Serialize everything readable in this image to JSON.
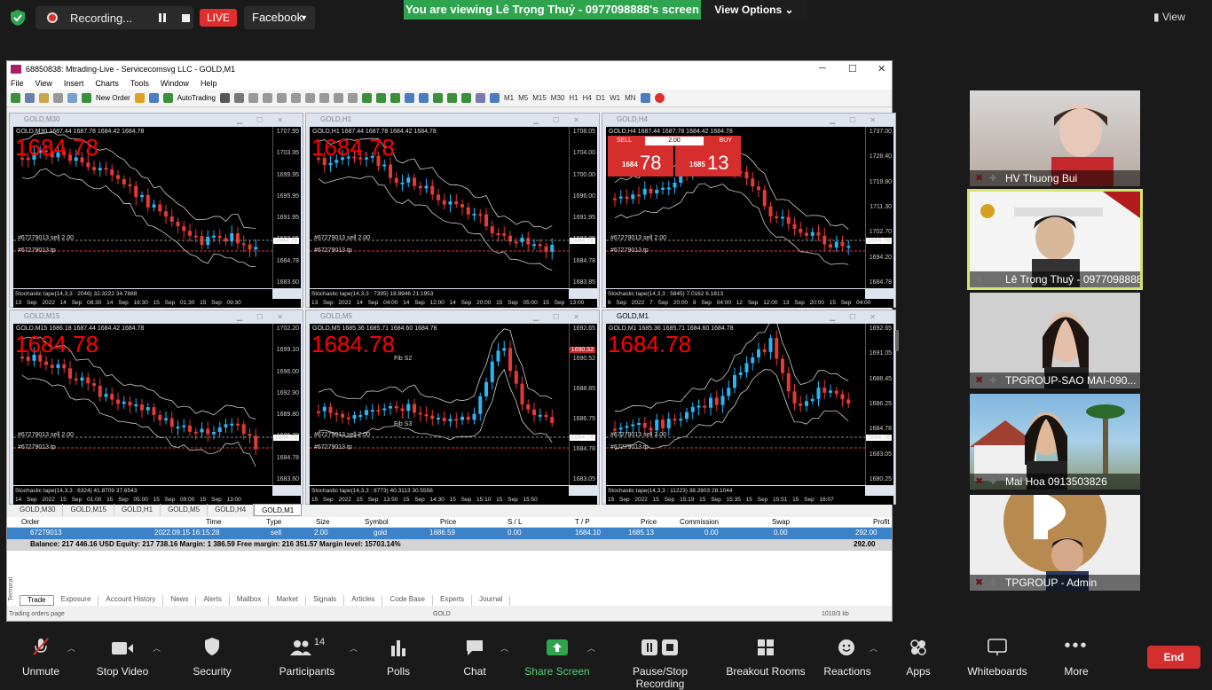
{
  "zoom": {
    "recording_label": "Recording...",
    "live_label": "LIVE",
    "stream_target": "Facebook",
    "viewing_banner": "You are viewing Lê Trọng Thuỷ - 0977098888's screen",
    "view_options": "View Options",
    "view_label": "View"
  },
  "mt": {
    "title": "68850838: Mtrading-Live - Servicecomsvg LLC - GOLD,M1",
    "menu": [
      "File",
      "View",
      "Insert",
      "Charts",
      "Tools",
      "Window",
      "Help"
    ],
    "toolbar": {
      "new_order": "New Order",
      "autotrading": "AutoTrading",
      "timeframes": [
        "M1",
        "M5",
        "M15",
        "M30",
        "H1",
        "H4",
        "D1",
        "W1",
        "MN"
      ]
    },
    "charts": [
      {
        "title": "GOLD,M30",
        "ohlc": "GOLD,M30  1687.44 1687.78 1684.42 1684.78",
        "price": "1684.78",
        "ord1": "#67279013 sell 2.00",
        "ord2": "#67279013 tp",
        "stoch": "Stochastic tape(14,3,3 : 2046) 32.3222 34.7888",
        "xaxis": "13 Sep 2022  14 Sep 08:30  14 Sep 16:30  15 Sep 01:30  15 Sep 09:30",
        "yticks": [
          "1707.95",
          "1703.95",
          "1699.95",
          "1695.95",
          "1691.95",
          "1687.95",
          "1684.78",
          "1683.60"
        ],
        "tag": "1684.78"
      },
      {
        "title": "GOLD,H1",
        "ohlc": "GOLD,H1  1687.44 1687.78 1684.42 1684.78",
        "price": "1684.78",
        "ord1": "#67279013 sell 2.00",
        "ord2": "#67279013 tp",
        "stoch": "Stochastic tape(14,3,3 : 7395) 18.8946 21.1953",
        "xaxis": "13 Sep 2022  14 Sep 04:00  14 Sep 12:00  14 Sep 20:00  15 Sep 05:00  15 Sep 13:00",
        "yticks": [
          "1708.05",
          "1704.00",
          "1700.00",
          "1696.00",
          "1691.95",
          "1687.95",
          "1684.78",
          "1683.85"
        ],
        "tag": "1684.78"
      },
      {
        "title": "GOLD,H4",
        "ohlc": "GOLD,H4  1687.44 1687.78 1684.42 1684.78",
        "ord1": "#67279013 sell 2.00",
        "ord2": "#67279013 tp",
        "stoch": "Stochastic tape(14,3,3 : 5845) 7.0162 6.1813",
        "xaxis": "6 Sep 2022  7 Sep 20:00  9 Sep 04:00  12 Sep 12:00  13 Sep 20:00  15 Sep 04:00",
        "yticks": [
          "1737.00",
          "1728.40",
          "1719.80",
          "1711.30",
          "1702.70",
          "1694.20",
          "1684.78"
        ],
        "tag": "1684.78",
        "trade": {
          "sell": "SELL",
          "buy": "BUY",
          "lot": "2.00",
          "sell_small": "1684",
          "sell_big": "78",
          "buy_small": "1685",
          "buy_big": "13"
        }
      },
      {
        "title": "GOLD,M15",
        "ohlc": "GOLD,M15  1686.18 1687.44 1684.42 1684.78",
        "price": "1684.78",
        "ord1": "#67279013 sell 2.00",
        "ord2": "#67279013 tp",
        "stoch": "Stochastic tape(14,3,3 : 6324) 41.8709 37.6543",
        "xaxis": "14 Sep 2022  15 Sep 01:00  15 Sep 05:00  15 Sep 09:00  15 Sep 13:00",
        "yticks": [
          "1702.20",
          "1699.10",
          "1696.00",
          "1692.90",
          "1689.80",
          "1686.70",
          "1684.78",
          "1683.60"
        ],
        "tag": "1684.78"
      },
      {
        "title": "GOLD,M5",
        "ohlc": "GOLD,M5  1685.36 1685.71 1684.60 1684.78",
        "price": "1684.78",
        "ord1": "#67279013 sell 2.00",
        "ord2": "#67279013 tp",
        "fib1": "Fib S2",
        "fib2": "Fib S3",
        "stoch": "Stochastic tape(14,3,3 : 8773) 40.3113 30.5556",
        "xaxis": "15 Sep 2022  15 Sep 13:50  15 Sep 14:30  15 Sep 15:10  15 Sep 15:50",
        "yticks": [
          "1692.65",
          "1690.52",
          "1688.85",
          "1686.75",
          "1684.78",
          "1683.05"
        ],
        "tag": "1684.78",
        "tag2": "1690.52"
      },
      {
        "title": "GOLD,M1",
        "ohlc": "GOLD,M1  1685.36 1685.71 1684.60 1684.78",
        "price": "1684.78",
        "ord1": "#67279013 sell 2.00",
        "ord2": "#67279013 tp",
        "stoch": "Stochastic tape(14,3,3 : 11223) 38.2803 28.1044",
        "xaxis": "15 Sep 2022  15 Sep 15:19  15 Sep 15:35  15 Sep 15:51  15 Sep 16:07",
        "yticks": [
          "1692.65",
          "1691.05",
          "1688.45",
          "1686.25",
          "1684.78",
          "1683.05",
          "1680.25"
        ],
        "tag": "1684.78"
      }
    ],
    "chart_tabs": [
      "GOLD,M30",
      "GOLD,M15",
      "GOLD,H1",
      "GOLD,M5",
      "GOLD,H4",
      "GOLD,M1"
    ],
    "terminal": {
      "headers": [
        "Order",
        "Time",
        "Type",
        "Size",
        "Symbol",
        "Price",
        "S / L",
        "T / P",
        "Price",
        "Commission",
        "Swap",
        "Profit"
      ],
      "row": [
        "67279013",
        "2022.09.15 16:15:28",
        "sell",
        "2.00",
        "gold",
        "1686.59",
        "0.00",
        "1684.10",
        "1685.13",
        "0.00",
        "0.00",
        "292.00"
      ],
      "balance": "Balance: 217 446.16 USD  Equity: 217 738.16  Margin: 1 386.59  Free margin: 216 351.57  Margin level: 15703.14%",
      "balance_profit": "292.00",
      "tabs": [
        "Trade",
        "Exposure",
        "Account History",
        "News",
        "Alerts",
        "Mailbox",
        "Market",
        "Signals",
        "Articles",
        "Code Base",
        "Experts",
        "Journal"
      ],
      "label": "Terminal"
    },
    "status": {
      "left": "Trading orders page",
      "symbol": "GOLD",
      "right": "1010/3 kb"
    }
  },
  "participants": [
    {
      "name": "HV Thuong Bui"
    },
    {
      "name": "Lê Trọng Thuỷ - 0977098888"
    },
    {
      "name": "TPGROUP-SAO MAI-090..."
    },
    {
      "name": "Mai Hoa 0913503826"
    },
    {
      "name": "TPGROUP - Admin"
    }
  ],
  "bottombar": {
    "unmute": "Unmute",
    "stop_video": "Stop Video",
    "security": "Security",
    "participants": "Participants",
    "participants_count": "14",
    "polls": "Polls",
    "chat": "Chat",
    "share": "Share Screen",
    "pause_rec": "Pause/Stop Recording",
    "breakout": "Breakout Rooms",
    "reactions": "Reactions",
    "apps": "Apps",
    "whiteboards": "Whiteboards",
    "more": "More",
    "end": "End"
  },
  "colors": {
    "share_green": "#2ea44f",
    "end_red": "#d32f2f",
    "live_red": "#e02e2e",
    "bull": "#29b6f6",
    "bear": "#e53935"
  }
}
